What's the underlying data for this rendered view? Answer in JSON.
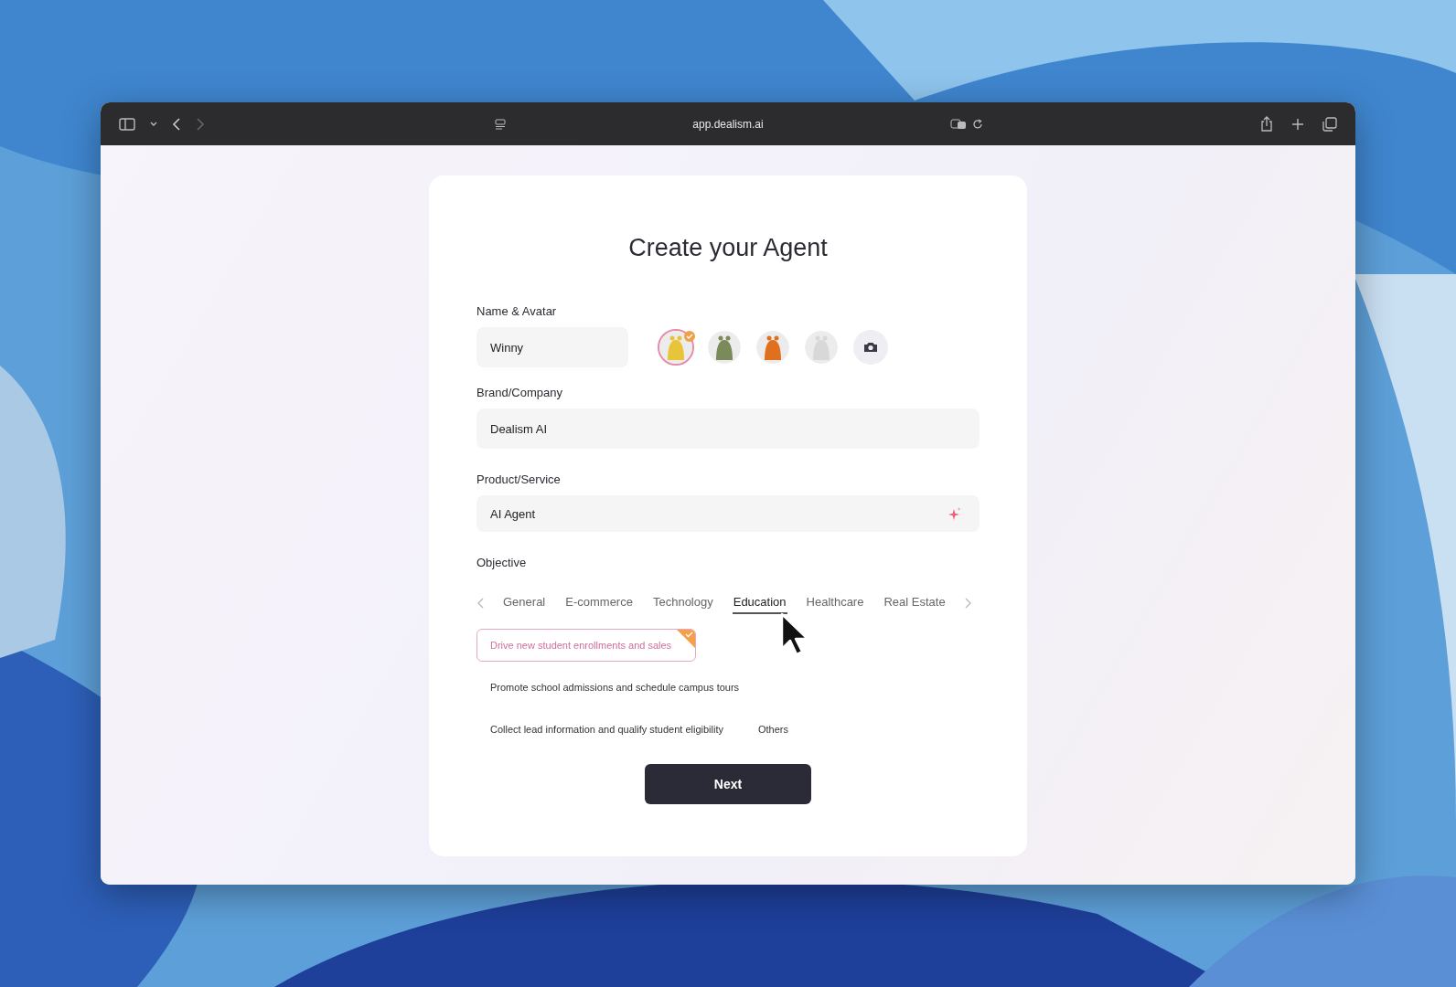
{
  "browser": {
    "url": "app.dealism.ai"
  },
  "title": "Create your Agent",
  "name_field": {
    "label": "Name & Avatar",
    "value": "Winny"
  },
  "avatars": [
    {
      "color": "#e8c43a",
      "selected": true
    },
    {
      "color": "#7a8a5a",
      "selected": false
    },
    {
      "color": "#e0701e",
      "selected": false
    },
    {
      "color": "#d8d8d8",
      "selected": false
    }
  ],
  "brand_field": {
    "label": "Brand/Company",
    "value": "Dealism AI"
  },
  "product_field": {
    "label": "Product/Service",
    "value": "AI Agent"
  },
  "objective": {
    "label": "Objective",
    "tabs": [
      {
        "label": "General",
        "selected": false
      },
      {
        "label": "E-commerce",
        "selected": false
      },
      {
        "label": "Technology",
        "selected": false
      },
      {
        "label": "Education",
        "selected": true
      },
      {
        "label": "Healthcare",
        "selected": false
      },
      {
        "label": "Real Estate",
        "selected": false
      }
    ],
    "options": [
      {
        "label": "Drive new student enrollments and sales",
        "selected": true
      },
      {
        "label": "Promote school admissions and schedule campus tours",
        "selected": false
      },
      {
        "label": "Collect lead information and qualify student eligibility",
        "selected": false
      },
      {
        "label": "Others",
        "selected": false
      }
    ]
  },
  "next_button": "Next"
}
